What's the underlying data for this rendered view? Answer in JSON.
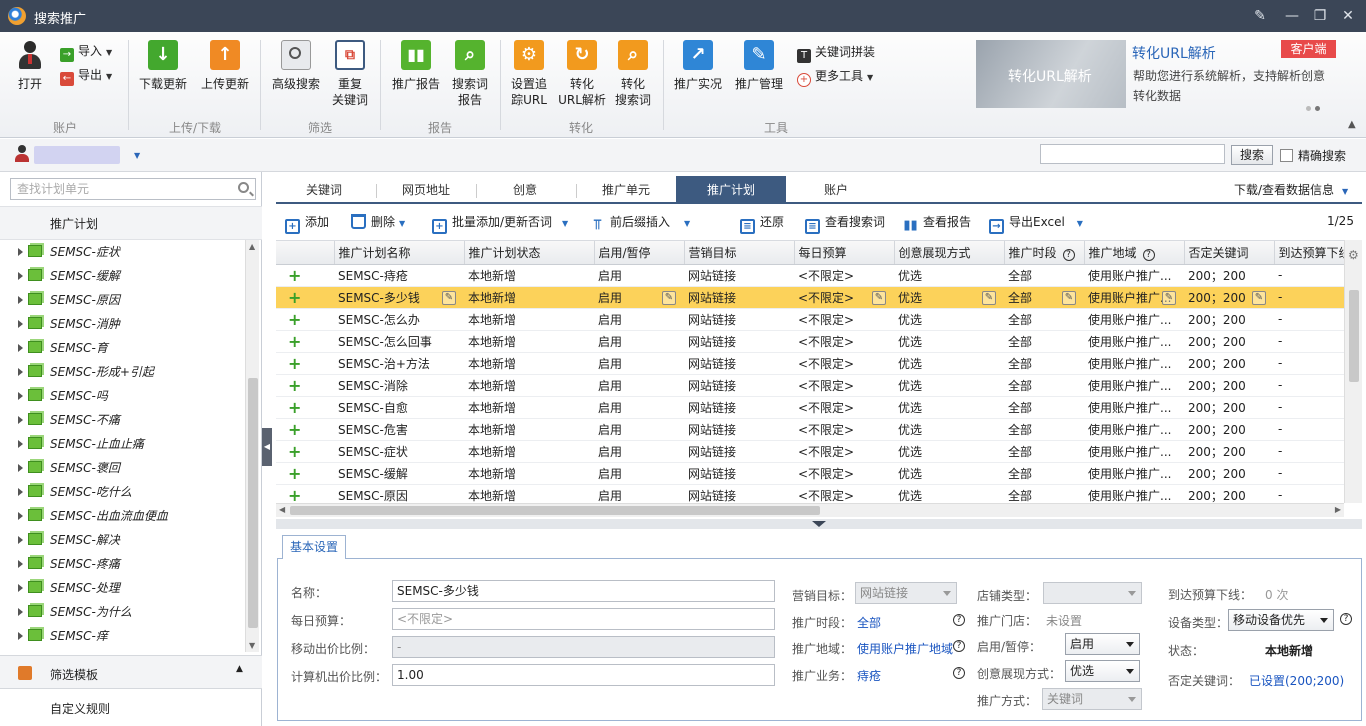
{
  "window": {
    "title": "搜索推广"
  },
  "colors": {
    "titlebar": "#3b4657",
    "accent": "#3d5a80",
    "selected_row": "#fcd25a",
    "link": "#1a55c0",
    "badge": "#e84a4a"
  },
  "ribbon": {
    "open": "打开",
    "import": "导入",
    "export": "导出",
    "download": "下载更新",
    "upload": "上传更新",
    "advanced_search": "高级搜索",
    "dup_kw_1": "重复",
    "dup_kw_2": "关键词",
    "promo_report": "推广报告",
    "search_report_1": "搜索词",
    "search_report_2": "报告",
    "track_1": "设置追",
    "track_2": "踪URL",
    "conv_url_1": "转化",
    "conv_url_2": "URL解析",
    "conv_search_1": "转化",
    "conv_search_2": "搜索词",
    "live": "推广实况",
    "manage": "推广管理",
    "kw_assemble": "关键词拼装",
    "more_tools": "更多工具",
    "groups": {
      "account": "账户",
      "updown": "上传/下载",
      "filter": "筛选",
      "report": "报告",
      "conversion": "转化",
      "tools": "工具"
    }
  },
  "ad": {
    "banner": "转化URL解析",
    "title": "转化URL解析",
    "badge": "客户端",
    "desc": "帮助您进行系统解析，支持解析创意转化数据"
  },
  "account_bar": {
    "search_button": "搜索",
    "exact_search": "精确搜索"
  },
  "sidebar": {
    "search_placeholder": "查找计划单元",
    "header": "推广计划",
    "items": [
      "SEMSC-症状",
      "SEMSC-缓解",
      "SEMSC-原因",
      "SEMSC-消肿",
      "SEMSC-育",
      "SEMSC-形成+引起",
      "SEMSC-吗",
      "SEMSC-不痛",
      "SEMSC-止血止痛",
      "SEMSC-褒回",
      "SEMSC-吃什么",
      "SEMSC-出血流血便血",
      "SEMSC-解决",
      "SEMSC-疼痛",
      "SEMSC-处理",
      "SEMSC-为什么",
      "SEMSC-痒"
    ],
    "filter_template": "筛选模板",
    "custom_rule": "自定义规则"
  },
  "tabs": {
    "items": [
      "关键词",
      "网页地址",
      "创意",
      "推广单元",
      "推广计划",
      "账户"
    ],
    "active": "推广计划",
    "download_info": "下载/查看数据信息"
  },
  "toolbar": {
    "add": "添加",
    "delete": "删除",
    "batch": "批量添加/更新否词",
    "insert": "前后缀插入",
    "restore": "还原",
    "view_search": "查看搜索词",
    "view_report": "查看报告",
    "export": "导出Excel",
    "page": "1/25"
  },
  "table": {
    "columns": [
      "推广计划名称",
      "推广计划状态",
      "启用/暂停",
      "营销目标",
      "每日预算",
      "创意展现方式",
      "推广时段",
      "推广地域",
      "否定关键词",
      "到达预算下线"
    ],
    "selected_index": 1,
    "rows": [
      {
        "name": "SEMSC-痔疮",
        "status": "本地新增",
        "enable": "启用",
        "target": "网站链接",
        "budget": "<不限定>",
        "display": "优选",
        "period": "全部",
        "region": "使用账户推广...",
        "negative": "200；200",
        "arrival": "-"
      },
      {
        "name": "SEMSC-多少钱",
        "status": "本地新增",
        "enable": "启用",
        "target": "网站链接",
        "budget": "<不限定>",
        "display": "优选",
        "period": "全部",
        "region": "使用账户推广...",
        "negative": "200；200",
        "arrival": "-"
      },
      {
        "name": "SEMSC-怎么办",
        "status": "本地新增",
        "enable": "启用",
        "target": "网站链接",
        "budget": "<不限定>",
        "display": "优选",
        "period": "全部",
        "region": "使用账户推广...",
        "negative": "200；200",
        "arrival": "-"
      },
      {
        "name": "SEMSC-怎么回事",
        "status": "本地新增",
        "enable": "启用",
        "target": "网站链接",
        "budget": "<不限定>",
        "display": "优选",
        "period": "全部",
        "region": "使用账户推广...",
        "negative": "200；200",
        "arrival": "-"
      },
      {
        "name": "SEMSC-治+方法",
        "status": "本地新增",
        "enable": "启用",
        "target": "网站链接",
        "budget": "<不限定>",
        "display": "优选",
        "period": "全部",
        "region": "使用账户推广...",
        "negative": "200；200",
        "arrival": "-"
      },
      {
        "name": "SEMSC-消除",
        "status": "本地新增",
        "enable": "启用",
        "target": "网站链接",
        "budget": "<不限定>",
        "display": "优选",
        "period": "全部",
        "region": "使用账户推广...",
        "negative": "200；200",
        "arrival": "-"
      },
      {
        "name": "SEMSC-自愈",
        "status": "本地新增",
        "enable": "启用",
        "target": "网站链接",
        "budget": "<不限定>",
        "display": "优选",
        "period": "全部",
        "region": "使用账户推广...",
        "negative": "200；200",
        "arrival": "-"
      },
      {
        "name": "SEMSC-危害",
        "status": "本地新增",
        "enable": "启用",
        "target": "网站链接",
        "budget": "<不限定>",
        "display": "优选",
        "period": "全部",
        "region": "使用账户推广...",
        "negative": "200；200",
        "arrival": "-"
      },
      {
        "name": "SEMSC-症状",
        "status": "本地新增",
        "enable": "启用",
        "target": "网站链接",
        "budget": "<不限定>",
        "display": "优选",
        "period": "全部",
        "region": "使用账户推广...",
        "negative": "200；200",
        "arrival": "-"
      },
      {
        "name": "SEMSC-缓解",
        "status": "本地新增",
        "enable": "启用",
        "target": "网站链接",
        "budget": "<不限定>",
        "display": "优选",
        "period": "全部",
        "region": "使用账户推广...",
        "negative": "200；200",
        "arrival": "-"
      },
      {
        "name": "SEMSC-原因",
        "status": "本地新增",
        "enable": "启用",
        "target": "网站链接",
        "budget": "<不限定>",
        "display": "优选",
        "period": "全部",
        "region": "使用账户推广...",
        "negative": "200；200",
        "arrival": "-"
      }
    ]
  },
  "form": {
    "tab": "基本设置",
    "name_label": "名称：",
    "name_value": "SEMSC-多少钱",
    "budget_label": "每日预算：",
    "budget_placeholder": "<不限定>",
    "mobile_label": "移动出价比例：",
    "mobile_value": "-",
    "pc_label": "计算机出价比例：",
    "pc_value": "1.00",
    "target_label": "营销目标：",
    "target_value": "网站链接",
    "period_label": "推广时段：",
    "period_value": "全部",
    "region_label": "推广地域：",
    "region_value": "使用账户推广地域",
    "business_label": "推广业务：",
    "business_value": "痔疮",
    "shop_type_label": "店铺类型：",
    "shop_label": "推广门店：",
    "shop_value": "未设置",
    "enable_label": "启用/暂停：",
    "enable_value": "启用",
    "display_label": "创意展现方式：",
    "display_value": "优选",
    "method_label": "推广方式：",
    "method_value": "关键词",
    "arrival_label": "到达预算下线：",
    "arrival_value": "0 次",
    "device_label": "设备类型：",
    "device_value": "移动设备优先",
    "status_label": "状态：",
    "status_value": "本地新增",
    "neg_label": "否定关键词：",
    "neg_value": "已设置(200;200)"
  }
}
